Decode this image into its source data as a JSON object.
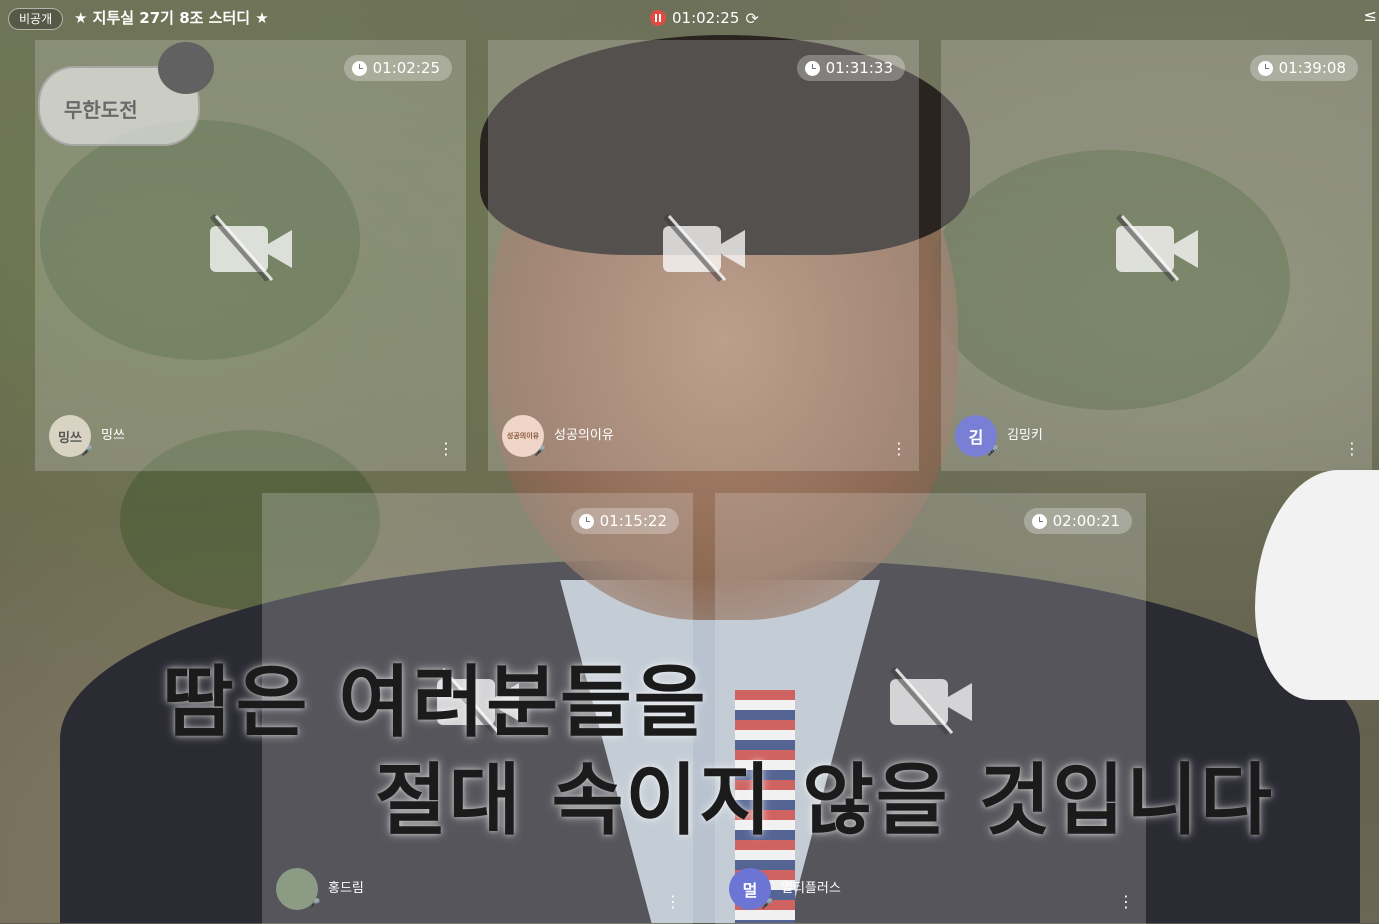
{
  "topbar": {
    "private_label": "비공개",
    "room_title": "★ 지투실 27기 8조 스터디 ★",
    "timer": "01:02:25",
    "edge_glyph": "≤"
  },
  "logo_text": "무한도전",
  "tiles": [
    {
      "timer": "01:02:25",
      "name": "밍쓰",
      "avatar_text": "밍쓰",
      "avatar_color": "#d9d3c3"
    },
    {
      "timer": "01:31:33",
      "name": "성공의이유",
      "avatar_text": "성공의이유",
      "avatar_color": "#efd6c8"
    },
    {
      "timer": "01:39:08",
      "name": "김밍키",
      "avatar_text": "김",
      "avatar_color": "#7a7fd6"
    },
    {
      "timer": "01:15:22",
      "name": "홍드림",
      "avatar_text": "",
      "avatar_color": "#8c9b83"
    },
    {
      "timer": "02:00:21",
      "name": "멀티플러스",
      "avatar_text": "멀",
      "avatar_color": "#6c74d4"
    }
  ],
  "subtitle": {
    "line1": "땀은 여러분들을",
    "line2": "절대 속이지 않을 것입니다"
  },
  "icons": {
    "record": "pause-record-icon",
    "refresh": "refresh-icon",
    "clock": "clock-icon",
    "camera_off": "camera-off-icon",
    "mic_off": "mic-off-icon",
    "more": "more-vertical-icon"
  }
}
